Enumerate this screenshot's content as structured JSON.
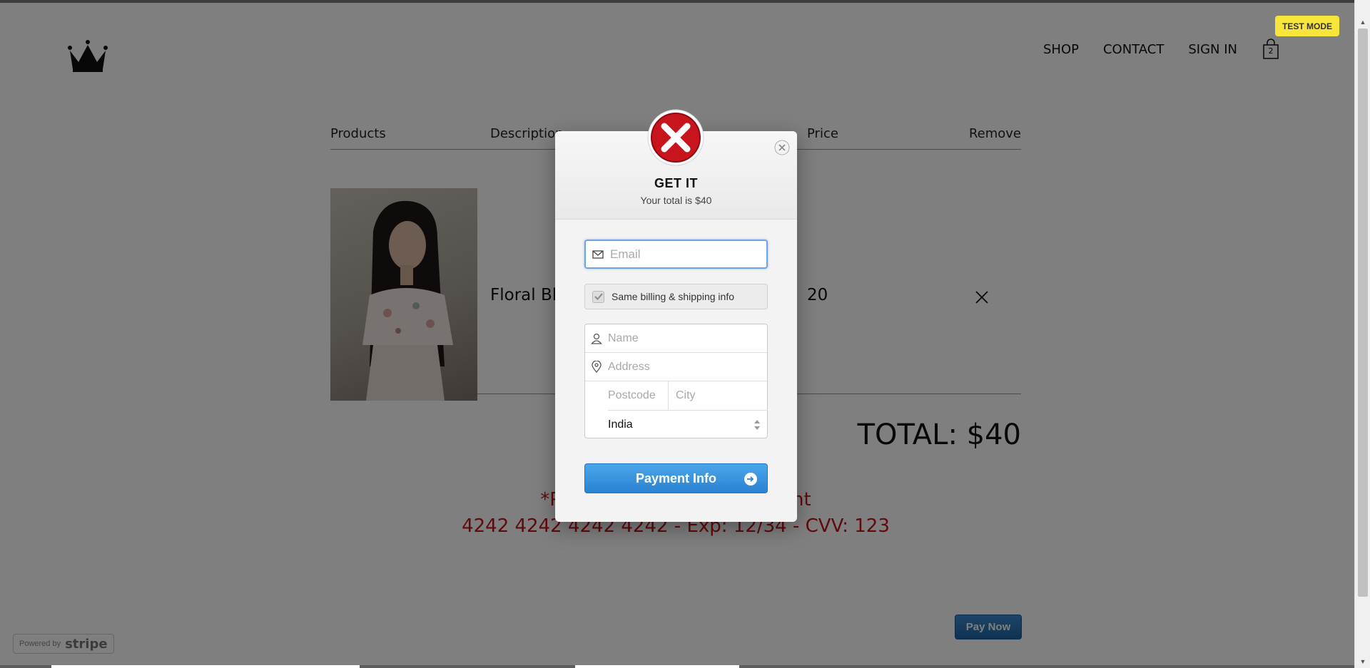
{
  "nav": {
    "items": [
      {
        "label": "SHOP"
      },
      {
        "label": "CONTACT"
      },
      {
        "label": "SIGN IN"
      }
    ],
    "cart_count": "2"
  },
  "test_mode_badge": "TEST MODE",
  "cart": {
    "headers": {
      "products": "Products",
      "description": "Description",
      "price": "Price",
      "remove": "Remove"
    },
    "item": {
      "description": "Floral Blo",
      "price": "20"
    },
    "total": "TOTAL: $40",
    "notice_line1": "*Please use th                                     d for payment",
    "notice_line2": "4242 4242 4242 4242 - Exp: 12/34 - CVV: 123"
  },
  "pay_now_label": "Pay Now",
  "powered_by": {
    "prefix": "Powered by",
    "brand": "stripe"
  },
  "modal": {
    "title": "GET IT",
    "subtitle": "Your total is $40",
    "email_placeholder": "Email",
    "same_billing_label": "Same billing & shipping info",
    "same_billing_checked": true,
    "name_placeholder": "Name",
    "address_placeholder": "Address",
    "postcode_placeholder": "Postcode",
    "city_placeholder": "City",
    "country": "India",
    "payment_button": "Payment Info"
  },
  "colors": {
    "accent_blue": "#2a82d2",
    "notice_red": "#c0141a",
    "test_mode_yellow": "#f7e53b"
  }
}
